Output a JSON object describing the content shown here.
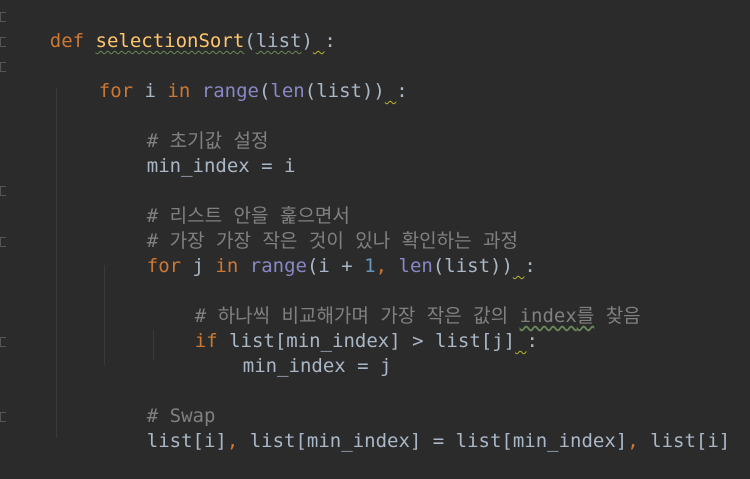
{
  "code": {
    "line1": {
      "kw_def": "def",
      "fn_name": "selectionSort",
      "open": "(",
      "param": "list",
      "close": ")",
      "space": " ",
      "colon": ":"
    },
    "line2": {
      "kw_for": "for",
      "var_i": " i ",
      "kw_in": "in",
      "sp": " ",
      "bi_range": "range",
      "p1": "(",
      "bi_len": "len",
      "p2": "(list))",
      "space": " ",
      "colon": ":"
    },
    "line3": {
      "comment": "# 초기값 설정"
    },
    "line4": {
      "code": "min_index = i"
    },
    "line5": {
      "comment": "# 리스트 안을 훑으면서"
    },
    "line6": {
      "comment": "# 가장 가장 작은 것이 있나 확인하는 과정"
    },
    "line7": {
      "kw_for": "for",
      "var_j": " j ",
      "kw_in": "in",
      "sp": " ",
      "bi_range": "range",
      "p1": "(i + ",
      "num": "1",
      "comma": ", ",
      "bi_len": "len",
      "p2": "(list))",
      "space": " ",
      "colon": ":"
    },
    "line8": {
      "comment_a": "# 하나씩 비교해가며 가장 작은 값의 ",
      "comment_b": "index",
      "comment_c": "를",
      "comment_d": " 찾음"
    },
    "line9": {
      "kw_if": "if",
      "code": " list[min_index] > list[j]",
      "space": " ",
      "colon": ":"
    },
    "line10": {
      "code": "min_index = j"
    },
    "line11": {
      "comment": "# Swap"
    },
    "line12": {
      "a": "list[i]",
      "comma1": ",",
      "b": " list[min_index] = list[min_index]",
      "comma2": ",",
      "c": " list[i]"
    }
  }
}
